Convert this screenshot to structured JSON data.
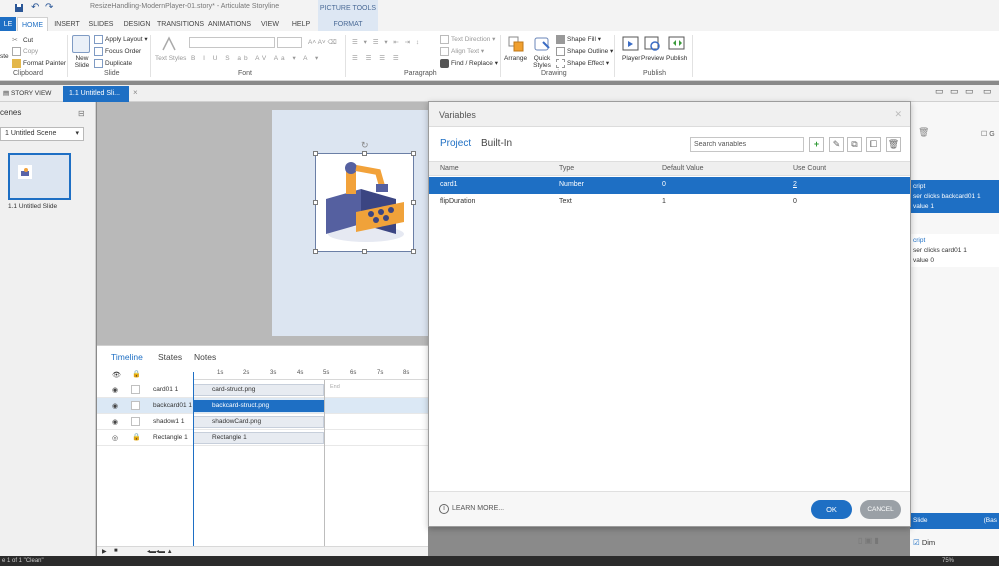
{
  "window": {
    "title": "ResizeHandling-ModernPlayer-01.story* - Articulate Storyline",
    "picture_tools_label": "PICTURE TOOLS"
  },
  "ribbon_tabs": [
    "LE",
    "HOME",
    "INSERT",
    "SLIDES",
    "DESIGN",
    "TRANSITIONS",
    "ANIMATIONS",
    "VIEW",
    "HELP",
    "FORMAT"
  ],
  "clipboard": {
    "paste": "ste",
    "cut": "Cut",
    "copy": "Copy",
    "format_painter": "Format Painter",
    "label": "Clipboard"
  },
  "slide_group": {
    "new_slide": "New Slide",
    "apply_layout": "Apply Layout",
    "focus_order": "Focus Order",
    "duplicate": "Duplicate",
    "label": "Slide"
  },
  "font_group": {
    "text_styles": "Text Styles",
    "label": "Font"
  },
  "paragraph_group": {
    "text_direction": "Text Direction",
    "align_text": "Align Text",
    "find_replace": "Find / Replace",
    "label": "Paragraph"
  },
  "drawing_group": {
    "arrange": "Arrange",
    "quick_styles": "Quick Styles",
    "shape_fill": "Shape Fill",
    "shape_outline": "Shape Outline",
    "shape_effect": "Shape Effect",
    "label": "Drawing"
  },
  "publish_group": {
    "player": "Player",
    "preview": "Preview",
    "publish": "Publish",
    "label": "Publish"
  },
  "doc_tabs": {
    "story_view": "STORY VIEW",
    "slide_tab": "1.1 Untitled Sli..."
  },
  "left_pane": {
    "scenes_label": "cenes",
    "scene_select": "1 Untitled Scene",
    "slide_label": "1.1 Untitled Slide"
  },
  "timeline": {
    "tabs": [
      "Timeline",
      "States",
      "Notes"
    ],
    "ticks": [
      "1s",
      "2s",
      "3s",
      "4s",
      "5s",
      "6s",
      "7s",
      "8s"
    ],
    "end_label": "End",
    "rows": [
      {
        "name": "card01 1",
        "bar": "card-struct.png"
      },
      {
        "name": "backcard01 1",
        "bar": "backcard-struct.png"
      },
      {
        "name": "shadow1 1",
        "bar": "shadowCard.png"
      },
      {
        "name": "Rectangle 1",
        "bar": "Rectangle 1"
      }
    ]
  },
  "right_pane": {
    "trigger1": [
      "cript",
      "ser clicks backcard01 1",
      "value 1"
    ],
    "trigger2": [
      "cript",
      "ser clicks card01 1",
      "value 0"
    ],
    "bottom_label": "Slide",
    "bottom_label2": "(Bas",
    "dim_label": "Dim"
  },
  "dialog": {
    "title": "Variables",
    "tabs": {
      "project": "Project",
      "builtin": "Built-In"
    },
    "search_placeholder": "Search variables",
    "columns": [
      "Name",
      "Type",
      "Default Value",
      "Use Count"
    ],
    "variables": [
      {
        "name": "card1",
        "type": "Number",
        "default": "0",
        "use_count": "2"
      },
      {
        "name": "flipDuration",
        "type": "Text",
        "default": "1",
        "use_count": "0"
      }
    ],
    "learn_more": "LEARN MORE...",
    "ok": "OK",
    "cancel": "CANCEL"
  },
  "status": {
    "left": "e 1 of 1   \"Clean\"",
    "zoom": "75%"
  },
  "colors": {
    "accent": "#1e6fc4",
    "selection_row": "#dbe8f5",
    "cancel": "#9aa0a6"
  }
}
